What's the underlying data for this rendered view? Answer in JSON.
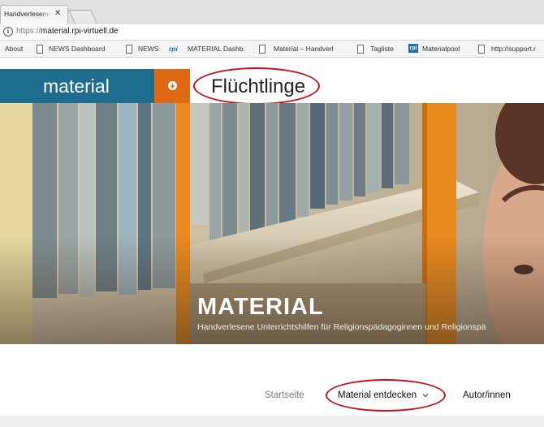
{
  "browser": {
    "tab_title": "Handverlesene",
    "tab_close": "✕",
    "url_scheme": "https://",
    "url_host": "material.rpi-virtuell.de",
    "bookmarks": [
      "About",
      "NEWS Dashboard",
      "NEWS",
      "MATERIAL Dashb.",
      "Material – Handverl",
      "Tagliste",
      "Materialpool",
      "http://support.r"
    ],
    "rpi_label": "rpi",
    "rpi_box_label": "rpi"
  },
  "header": {
    "brand": "material",
    "page_title": "Flüchtlinge",
    "brand_color": "#1f6d8e",
    "accent_color": "#e06a14",
    "highlight_color": "#c8101a"
  },
  "hero": {
    "title": "MATERIAL",
    "subtitle": "Handverlesene Unterrichtshilfen für Religionspädagoginnen und Religionspä"
  },
  "nav": {
    "home": "Startseite",
    "discover": "Material entdecken",
    "discover_chevron": "chevron-down-icon",
    "authors": "Autor/innen"
  }
}
